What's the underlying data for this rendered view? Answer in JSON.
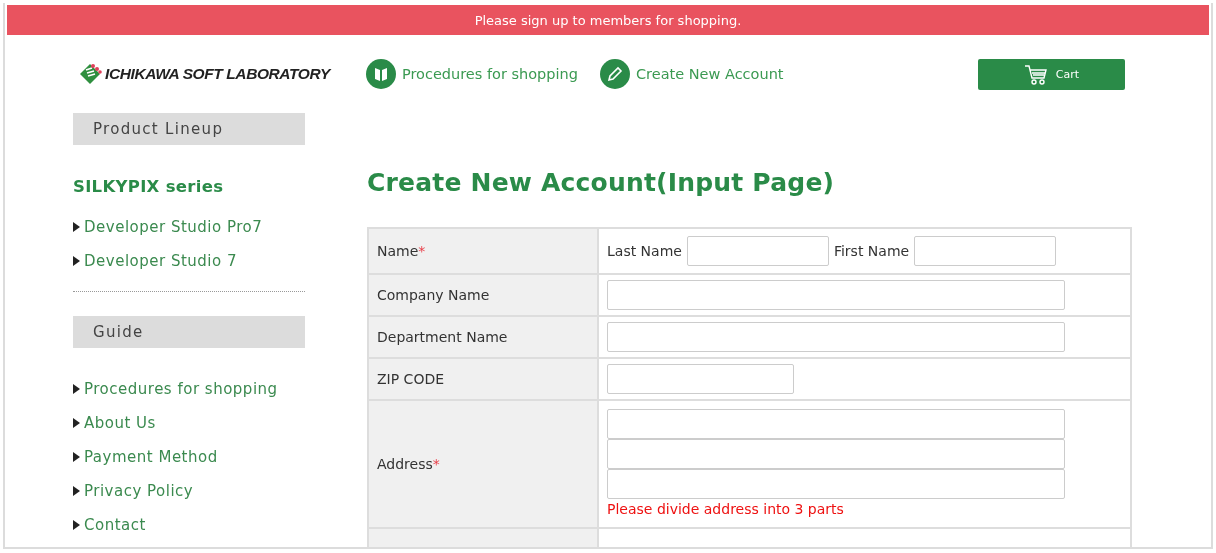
{
  "banner": {
    "text": "Please sign up to members for shopping."
  },
  "header": {
    "logo": "ICHIKAWA SOFT LABORATORY",
    "nav": [
      {
        "label": "Procedures for shopping"
      },
      {
        "label": "Create New Account"
      }
    ],
    "cart": {
      "label": "Cart"
    }
  },
  "sidebar": {
    "sections": [
      {
        "heading": "Product Lineup",
        "subheading": "SILKYPIX series",
        "links": [
          "Developer Studio Pro7",
          "Developer Studio 7"
        ]
      },
      {
        "heading": "Guide",
        "links": [
          "Procedures for shopping",
          "About Us",
          "Payment Method",
          "Privacy Policy",
          "Contact"
        ]
      }
    ]
  },
  "main": {
    "title": "Create New Account(Input Page)",
    "rows": [
      {
        "kind": "name",
        "label": "Name",
        "required_mark": "*",
        "parts": [
          "Last Name",
          "First Name"
        ]
      },
      {
        "kind": "text",
        "label": "Company Name"
      },
      {
        "kind": "text",
        "label": "Department Name"
      },
      {
        "kind": "zip",
        "label": "ZIP CODE"
      },
      {
        "kind": "address",
        "label": "Address",
        "required_mark": "*",
        "note": "Please divide address into 3 parts"
      }
    ]
  }
}
